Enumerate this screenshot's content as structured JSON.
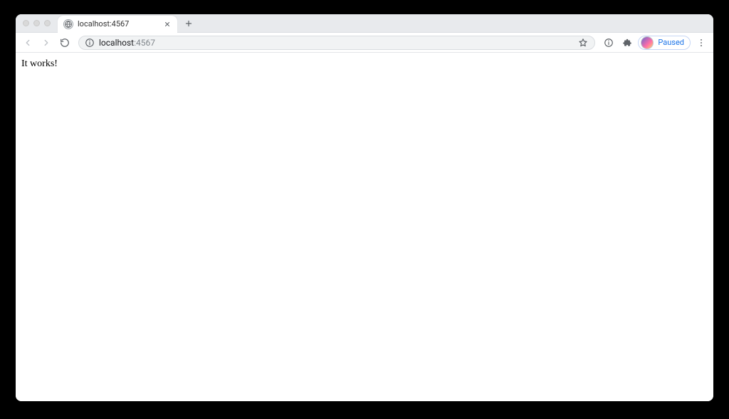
{
  "tab": {
    "title": "localhost:4567"
  },
  "address_bar": {
    "host": "localhost",
    "port": ":4567"
  },
  "profile": {
    "status_label": "Paused"
  },
  "page": {
    "body_text": "It works!"
  }
}
